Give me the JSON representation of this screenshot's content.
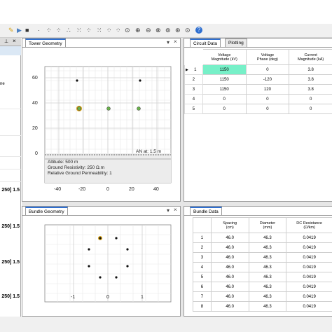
{
  "toolbar": {
    "icons": [
      "pencil-icon",
      "play-icon",
      "stop-icon",
      "dot-icon",
      "dot-icon",
      "dot-icon",
      "dot-icon",
      "dot-icon",
      "dot-icon",
      "dot-icon",
      "dot-icon",
      "dot-icon",
      "zoom-reset-icon",
      "zoom-in-icon",
      "zoom-out-icon",
      "zoom-fit-icon",
      "zoom-area-icon",
      "zoom-pan-icon",
      "help-icon"
    ]
  },
  "left_panel": {
    "header_icons": [
      "pin-icon",
      "close-icon"
    ],
    "fragment_text": "ne",
    "value_labels": [
      "250] 1.5",
      "250] 1.5",
      "250] 1.5",
      "250] 1.5"
    ]
  },
  "tower": {
    "tab_label": "Tower Geometry",
    "an_label": "AN at: 1.5 m",
    "info_lines": [
      "Altitude: 500 m",
      "Ground Resistivity: 250 Ω.m",
      "Relative Ground Permeability: 1"
    ],
    "x_ticks": [
      "-40",
      "-20",
      "0",
      "20",
      "40"
    ],
    "y_ticks": [
      "60",
      "40",
      "20",
      "0"
    ]
  },
  "bundle": {
    "tab_label": "Bundle Geometry",
    "x_ticks": [
      "-1",
      "0",
      "1"
    ]
  },
  "circuit": {
    "tabs": [
      "Circuit Data",
      "Plotting"
    ],
    "columns": [
      "Voltage\nMagnitude (kV)",
      "Voltage\nPhase (deg)",
      "Current\nMagnitude (kA)"
    ],
    "rows": [
      {
        "n": "1",
        "v": "1150",
        "p": "0",
        "c": "3.8"
      },
      {
        "n": "2",
        "v": "1150",
        "p": "-120",
        "c": "3.8"
      },
      {
        "n": "3",
        "v": "1150",
        "p": "120",
        "c": "3.8"
      },
      {
        "n": "4",
        "v": "0",
        "p": "0",
        "c": "0"
      },
      {
        "n": "5",
        "v": "0",
        "p": "0",
        "c": "0"
      }
    ]
  },
  "bundle_data": {
    "tab_label": "Bundle Data",
    "columns": [
      "Spacing\n(cm)",
      "Diameter\n(mm)",
      "DC Resistance\n(Ω/km)"
    ],
    "rows": [
      {
        "n": "1",
        "s": "46.0",
        "d": "46.3",
        "r": "0.0419"
      },
      {
        "n": "2",
        "s": "46.0",
        "d": "46.3",
        "r": "0.0419"
      },
      {
        "n": "3",
        "s": "46.0",
        "d": "46.3",
        "r": "0.0419"
      },
      {
        "n": "4",
        "s": "46.0",
        "d": "46.3",
        "r": "0.0419"
      },
      {
        "n": "5",
        "s": "46.0",
        "d": "46.3",
        "r": "0.0419"
      },
      {
        "n": "6",
        "s": "46.0",
        "d": "46.3",
        "r": "0.0419"
      },
      {
        "n": "7",
        "s": "46.0",
        "d": "46.3",
        "r": "0.0419"
      },
      {
        "n": "8",
        "s": "46.0",
        "d": "46.3",
        "r": "0.0419"
      }
    ]
  },
  "colors": {
    "highlight_cell": "#77f0c8",
    "conductor_green": "#6ab04c",
    "selected_ring": "#d4a017"
  }
}
